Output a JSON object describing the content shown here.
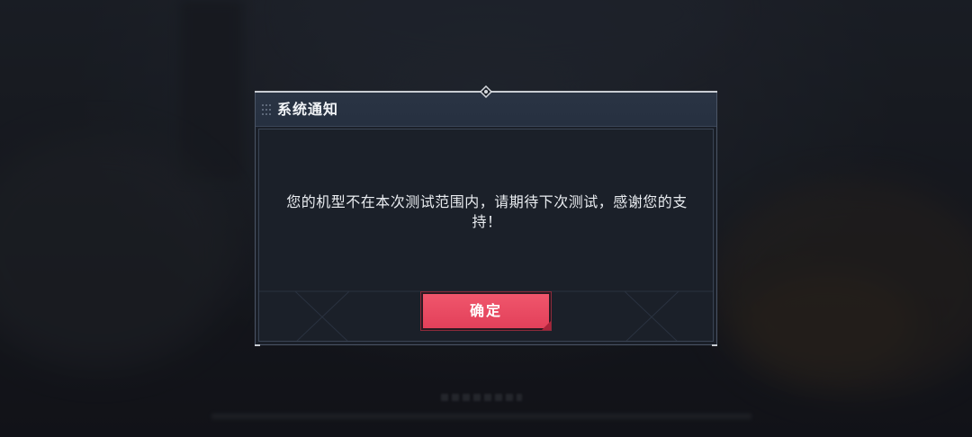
{
  "dialog": {
    "title": "系统通知",
    "message": "您的机型不在本次测试范围内，请期待下次测试，感谢您的支持！",
    "confirm_label": "确定"
  },
  "colors": {
    "confirm_button": "#e94a62",
    "header_bg": "#283243",
    "dialog_bg": "#1a1f28",
    "text": "#e9ecf0"
  },
  "icons": {
    "grip": "grip-dots-icon",
    "ornament": "diamond-ornament-icon"
  }
}
